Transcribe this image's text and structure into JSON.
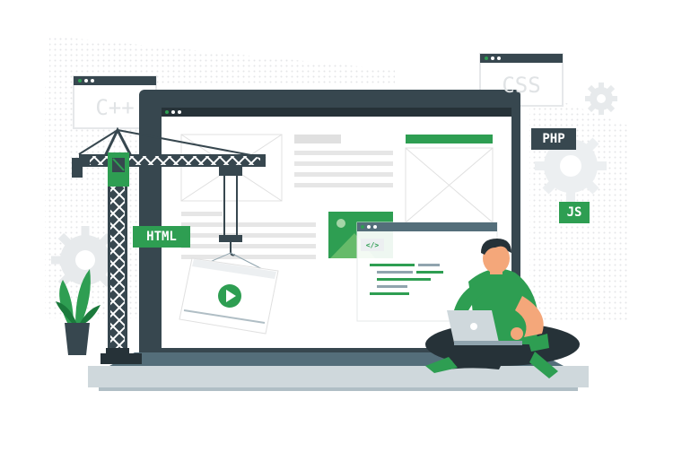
{
  "labels": {
    "cpp": "C++",
    "css": "CSS",
    "php": "PHP",
    "html": "HTML",
    "js": "JS",
    "code_tag": "</>"
  },
  "colors": {
    "accent_green": "#2e9e52",
    "dark": "#37474f",
    "light_gray": "#eceff1",
    "skin": "#f4a77a"
  },
  "icons": [
    "crane",
    "gear",
    "play",
    "laptop",
    "plant",
    "person"
  ]
}
